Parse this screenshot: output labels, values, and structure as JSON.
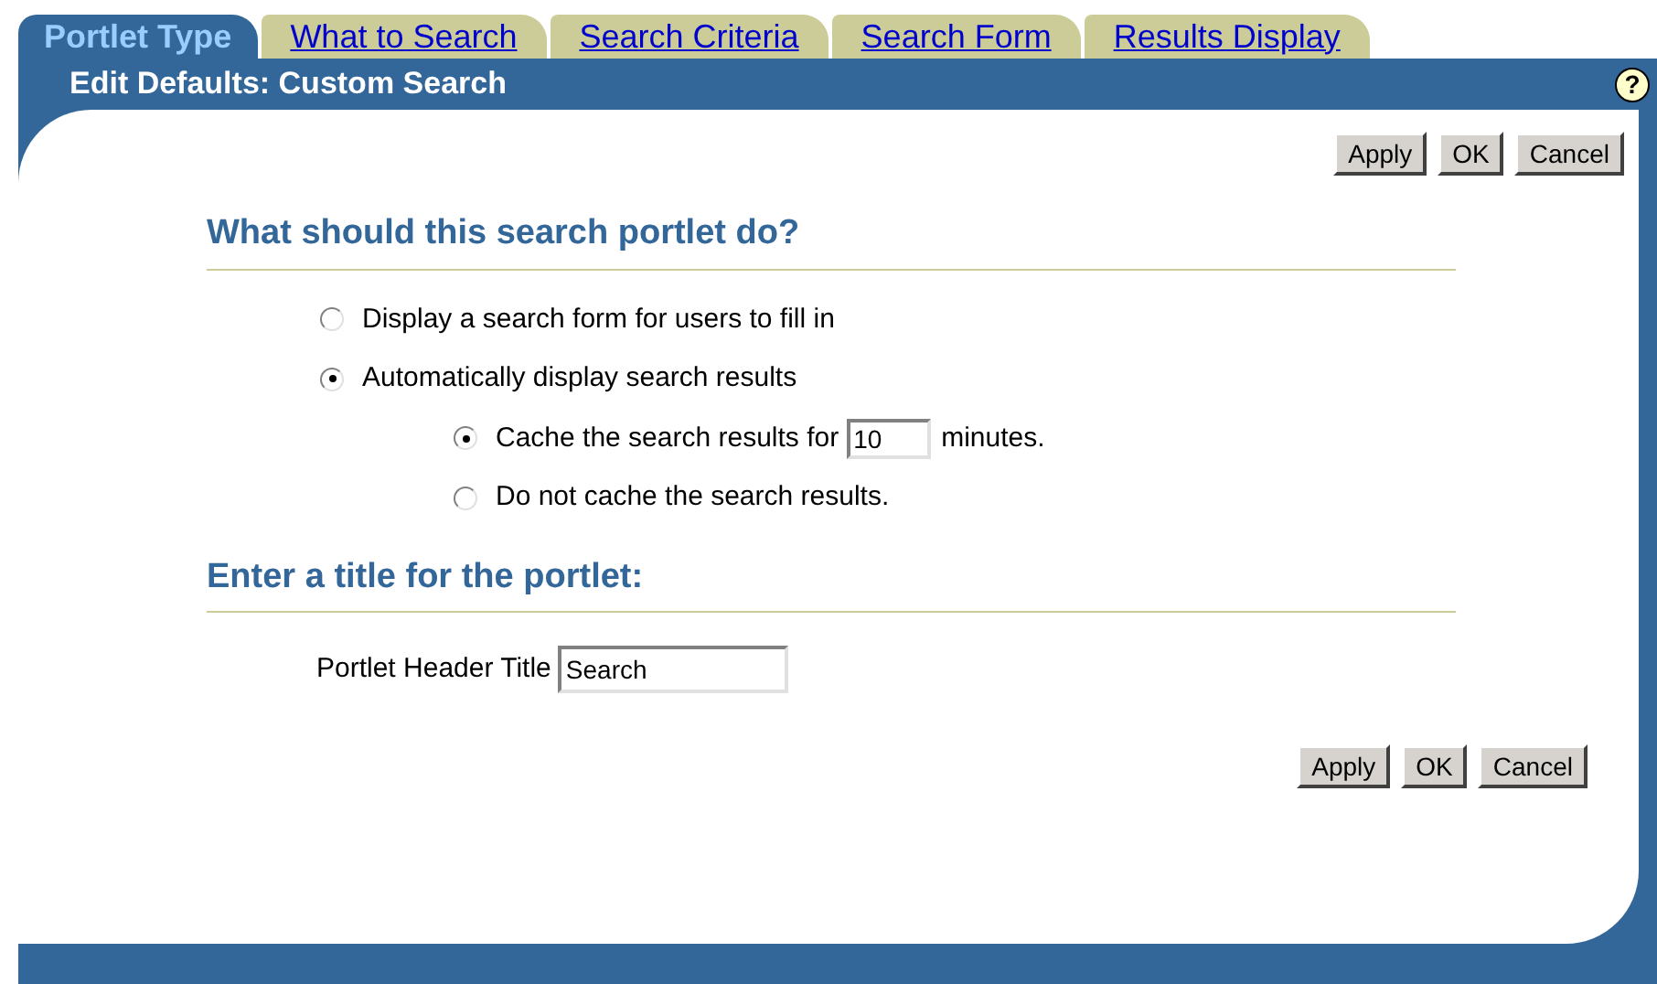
{
  "tabs": [
    {
      "label": "Portlet Type",
      "selected": true
    },
    {
      "label": "What to Search",
      "selected": false
    },
    {
      "label": "Search Criteria",
      "selected": false
    },
    {
      "label": "Search Form",
      "selected": false
    },
    {
      "label": "Results Display",
      "selected": false
    }
  ],
  "header": {
    "title": "Edit Defaults: Custom Search",
    "help_icon": "?"
  },
  "top_buttons": [
    "Apply",
    "OK",
    "Cancel"
  ],
  "sections": [
    {
      "heading": "What should this search portlet do?",
      "options": [
        {
          "label": "Display a search form for users to fill in",
          "selected": false
        },
        {
          "label": "Automatically display search results",
          "selected": true,
          "children": [
            {
              "label": "Cache the search results for",
              "value": "10",
              "suffix": "minutes.",
              "selected": true
            },
            {
              "label": "Do not cache the search results.",
              "selected": false
            }
          ]
        }
      ]
    },
    {
      "heading": "Enter a title for the portlet:",
      "field": {
        "label": "Portlet Header Title",
        "value": "Search"
      }
    }
  ],
  "bottom_buttons": [
    "Apply",
    "OK",
    "Cancel"
  ]
}
